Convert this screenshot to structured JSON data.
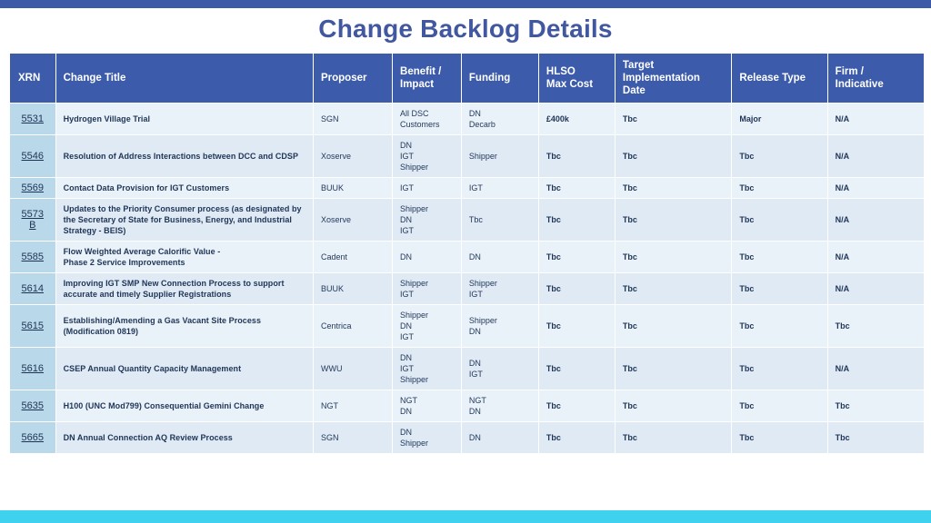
{
  "slide": {
    "title": "Change Backlog Details",
    "top_bar_color": "#3d5aa8",
    "bottom_bar_color": "#3fd2ee",
    "title_color": "#41579f",
    "header_color": "#3c5bab",
    "xrn_cell_color": "#b9d8e9",
    "row_color_a": "#eaf2f9",
    "row_color_b": "#dfeaf4"
  },
  "table": {
    "columns": [
      {
        "key": "xrn",
        "label": "XRN"
      },
      {
        "key": "title",
        "label": "Change Title"
      },
      {
        "key": "prop",
        "label": "Proposer"
      },
      {
        "key": "benefit",
        "label": "Benefit /\nImpact"
      },
      {
        "key": "funding",
        "label": "Funding"
      },
      {
        "key": "hlso",
        "label": "HLSO\nMax Cost"
      },
      {
        "key": "target",
        "label": "Target\nImplementation\nDate"
      },
      {
        "key": "release",
        "label": "Release Type"
      },
      {
        "key": "firm",
        "label": "Firm /\nIndicative"
      }
    ],
    "rows": [
      {
        "xrn": "5531",
        "xrn_suffix": "",
        "title": "Hydrogen Village Trial",
        "prop": "SGN",
        "benefit": "All DSC\nCustomers",
        "funding": "DN\nDecarb",
        "hlso": "£400k",
        "target": "Tbc",
        "release": "Major",
        "firm": "N/A"
      },
      {
        "xrn": "5546",
        "xrn_suffix": "",
        "title": "Resolution of Address Interactions between DCC and CDSP",
        "prop": "Xoserve",
        "benefit": "DN\nIGT\nShipper",
        "funding": "Shipper",
        "hlso": "Tbc",
        "target": "Tbc",
        "release": "Tbc",
        "firm": "N/A"
      },
      {
        "xrn": "5569",
        "xrn_suffix": "",
        "title": "Contact Data Provision for IGT Customers",
        "prop": "BUUK",
        "benefit": "IGT",
        "funding": "IGT",
        "hlso": "Tbc",
        "target": "Tbc",
        "release": "Tbc",
        "firm": "N/A"
      },
      {
        "xrn": "5573",
        "xrn_suffix": "B",
        "title": "Updates to the Priority Consumer process (as designated by the Secretary of State for Business, Energy, and Industrial Strategy  - BEIS)",
        "prop": "Xoserve",
        "benefit": "Shipper\nDN\nIGT",
        "funding": "Tbc",
        "hlso": "Tbc",
        "target": "Tbc",
        "release": "Tbc",
        "firm": "N/A"
      },
      {
        "xrn": "5585",
        "xrn_suffix": "",
        "title": "Flow Weighted Average Calorific Value -\nPhase 2 Service Improvements",
        "prop": "Cadent",
        "benefit": "DN",
        "funding": "DN",
        "hlso": "Tbc",
        "target": "Tbc",
        "release": "Tbc",
        "firm": "N/A"
      },
      {
        "xrn": "5614",
        "xrn_suffix": "",
        "title": "Improving IGT SMP New Connection Process to support accurate and timely Supplier Registrations",
        "prop": "BUUK",
        "benefit": "Shipper\nIGT",
        "funding": "Shipper\nIGT",
        "hlso": "Tbc",
        "target": "Tbc",
        "release": "Tbc",
        "firm": "N/A"
      },
      {
        "xrn": "5615",
        "xrn_suffix": "",
        "title": "Establishing/Amending a Gas Vacant Site Process (Modification 0819)",
        "prop": "Centrica",
        "benefit": "Shipper\nDN\nIGT",
        "funding": "Shipper\nDN",
        "hlso": "Tbc",
        "target": "Tbc",
        "release": "Tbc",
        "firm": "Tbc"
      },
      {
        "xrn": "5616",
        "xrn_suffix": "",
        "title": "CSEP Annual Quantity Capacity Management",
        "prop": "WWU",
        "benefit": "DN\nIGT\nShipper",
        "funding": "DN\nIGT",
        "hlso": "Tbc",
        "target": "Tbc",
        "release": "Tbc",
        "firm": "N/A"
      },
      {
        "xrn": "5635",
        "xrn_suffix": "",
        "title": "H100 (UNC Mod799) Consequential Gemini Change",
        "prop": "NGT",
        "benefit": "NGT\nDN",
        "funding": "NGT\nDN",
        "hlso": "Tbc",
        "target": "Tbc",
        "release": "Tbc",
        "firm": "Tbc"
      },
      {
        "xrn": "5665",
        "xrn_suffix": "",
        "title": "DN Annual Connection AQ Review Process",
        "prop": "SGN",
        "benefit": "DN\nShipper",
        "funding": "DN",
        "hlso": "Tbc",
        "target": "Tbc",
        "release": "Tbc",
        "firm": "Tbc"
      }
    ]
  }
}
